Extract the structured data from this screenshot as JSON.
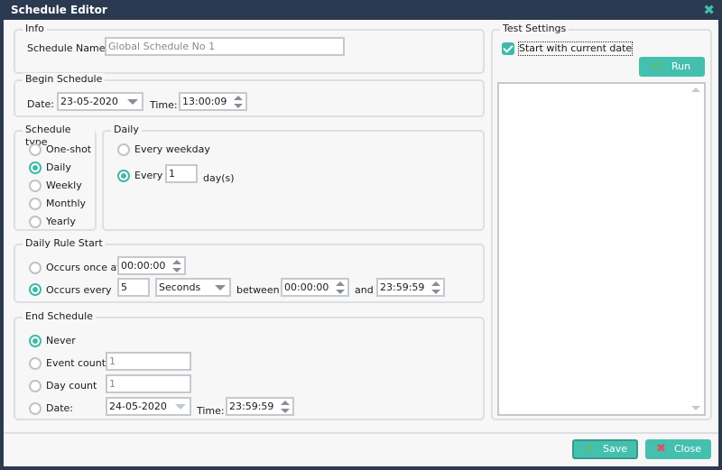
{
  "window": {
    "title": "Schedule Editor",
    "close_icon": "close-icon"
  },
  "info": {
    "legend": "Info",
    "schedule_name_label": "Schedule Name:",
    "schedule_name_value": "Global Schedule No 1"
  },
  "begin": {
    "legend": "Begin Schedule",
    "date_label": "Date:",
    "date_value": "23-05-2020",
    "time_label": "Time:",
    "time_value": "13:00:09"
  },
  "schedule_type": {
    "legend": "Schedule type",
    "options": [
      {
        "label": "One-shot",
        "selected": false
      },
      {
        "label": "Daily",
        "selected": true
      },
      {
        "label": "Weekly",
        "selected": false
      },
      {
        "label": "Monthly",
        "selected": false
      },
      {
        "label": "Yearly",
        "selected": false
      }
    ]
  },
  "daily": {
    "legend": "Daily",
    "every_weekday_label": "Every weekday",
    "every_label": "Every",
    "every_value": "1",
    "days_suffix": "day(s)"
  },
  "daily_rule": {
    "legend": "Daily Rule Start",
    "once_label": "Occurs once at",
    "once_value": "00:00:00",
    "every_label": "Occurs every",
    "every_value": "5",
    "unit_value": "Seconds",
    "between_label": "between",
    "between_value": "00:00:00",
    "and_label": "and",
    "and_value": "23:59:59"
  },
  "end": {
    "legend": "End Schedule",
    "never_label": "Never",
    "event_count_label": "Event count",
    "event_count_value": "1",
    "day_count_label": "Day count",
    "day_count_value": "1",
    "date_label": "Date:",
    "date_value": "24-05-2020",
    "time_label": "Time:",
    "time_value": "23:59:59"
  },
  "test": {
    "legend": "Test Settings",
    "start_current_label": "Start with current date",
    "start_current_checked": true,
    "run_label": "Run"
  },
  "footer": {
    "save_label": "Save",
    "close_label": "Close"
  },
  "colors": {
    "accent": "#45bfae",
    "titlebar": "#2b3a50",
    "close_x": "#e84a5f"
  }
}
